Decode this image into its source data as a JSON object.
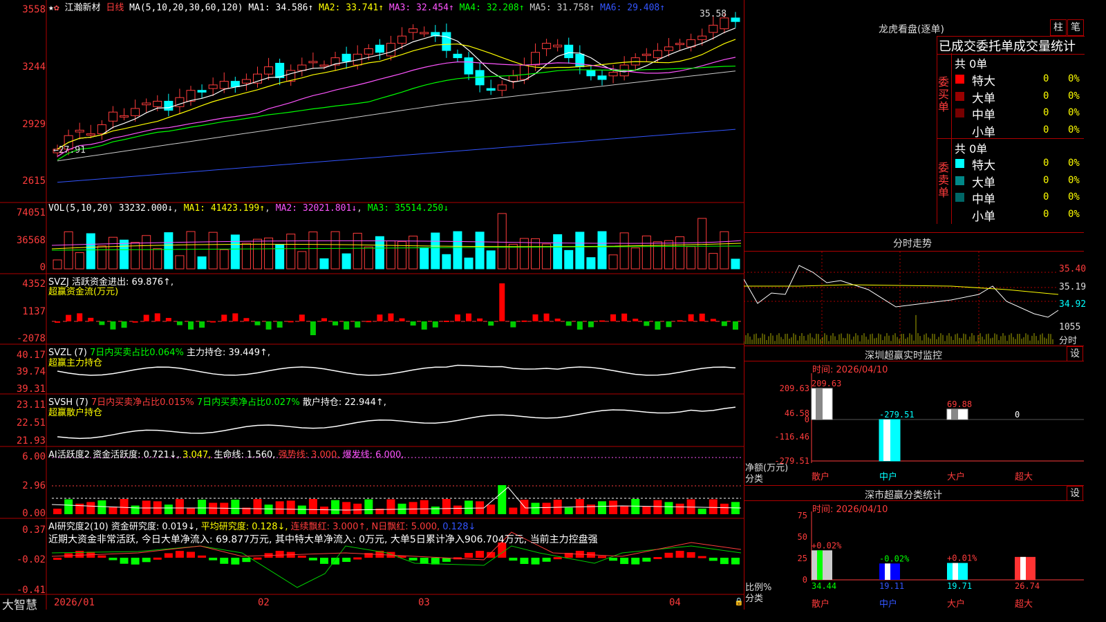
{
  "header": {
    "stock_name": "江瀚新材",
    "period": "日线",
    "ma_spec": "MA(5,10,20,30,60,120)",
    "ma": [
      {
        "label": "MA1: 34.586↑",
        "color": "#ffffff"
      },
      {
        "label": "MA2: 33.741↑",
        "color": "#ffff00"
      },
      {
        "label": "MA3: 32.454↑",
        "color": "#ff55ff"
      },
      {
        "label": "MA4: 32.208↑",
        "color": "#00ff00"
      },
      {
        "label": "MA5: 31.758↑",
        "color": "#cccccc"
      },
      {
        "label": "MA6: 29.408↑",
        "color": "#3355ff"
      }
    ],
    "high_mark": "35.58",
    "low_mark": "27.91"
  },
  "axes": {
    "price": [
      "3558",
      "3244",
      "2929",
      "2615"
    ],
    "vol": [
      "74051",
      "36568",
      "0"
    ],
    "svzj": [
      "4352",
      "1137",
      "-2078"
    ],
    "svzl": [
      "40.17",
      "39.74",
      "39.31"
    ],
    "svsh": [
      "23.11",
      "22.51",
      "21.93"
    ],
    "ai1": [
      "6.00",
      "2.96",
      "0.00"
    ],
    "ai2": [
      "0.37",
      "-0.02",
      "-0.41"
    ]
  },
  "panels": {
    "vol": {
      "spec": "VOL(5,10,20)",
      "v": "33232.000↓",
      "ma1": "MA1: 41423.199↑",
      "ma2": "MA2: 32021.801↓",
      "ma3": "MA3: 35514.250↓"
    },
    "svzj": {
      "spec": "SVZJ",
      "label": "活跃资金进出: 69.876↑,",
      "sub": "超赢资金流(万元)"
    },
    "svzl": {
      "spec": "SVZL (7)",
      "a": "7日内买卖占比0.064%",
      "b": "主力持仓: 39.449↑,",
      "sub": "超赢主力持仓"
    },
    "svsh": {
      "spec": "SVSH (7)",
      "a": "7日内买卖净占比0.015%",
      "b": "7日内买卖净占比0.027%",
      "c": "散户持仓: 22.944↑,",
      "sub": "超赢散户持仓"
    },
    "ai1": {
      "spec": "AI活跃度2",
      "a": "资金活跃度: 0.721↓,",
      "b": "3.047,",
      "c": "生命线: 1.560,",
      "d": "强势线: 3.000,",
      "e": "爆发线: 6.000,"
    },
    "ai2": {
      "spec": "AI研究度2(10)",
      "a": "资金研究度: 0.019↓,",
      "b": "平均研究度: 0.128↓,",
      "c": "连续飘红: 3.000↑,",
      "d": "N日飘红: 5.000,",
      "e": "0.128↓",
      "note": "近期大资金非常活跃, 今日大单净流入: 69.877万元, 其中特大单净流入: 0万元, 大单5日累计净入906.704万元, 当前主力控盘强"
    }
  },
  "x_axis": {
    "labels": [
      "2026/01",
      "02",
      "03",
      "04"
    ]
  },
  "footer": {
    "brand": "大智慧"
  },
  "lhb": {
    "title": "龙虎看盘(逐单)",
    "btn_col": "柱",
    "btn_pen": "笔",
    "tabs": "已成交委托单成交量统计",
    "buy_side": "委买单",
    "sell_side": "委卖单",
    "buy_total": "共 0单",
    "sell_total": "共 0单",
    "buy_rows": [
      {
        "name": "特大",
        "n": "0",
        "p": "0%",
        "c": "#ff0000"
      },
      {
        "name": "大单",
        "n": "0",
        "p": "0%",
        "c": "#990000"
      },
      {
        "name": "中单",
        "n": "0",
        "p": "0%",
        "c": "#770000"
      },
      {
        "name": "小单",
        "n": "0",
        "p": "0%",
        "c": ""
      }
    ],
    "sell_rows": [
      {
        "name": "特大",
        "n": "0",
        "p": "0%",
        "c": "#00ffff"
      },
      {
        "name": "大单",
        "n": "0",
        "p": "0%",
        "c": "#008888"
      },
      {
        "name": "中单",
        "n": "0",
        "p": "0%",
        "c": "#006666"
      },
      {
        "name": "小单",
        "n": "0",
        "p": "0%",
        "c": ""
      }
    ]
  },
  "intraday": {
    "title": "分时走势",
    "p1": "35.40",
    "p2": "35.19",
    "p3": "34.92",
    "vol": "1055",
    "unit": "分时"
  },
  "monitor": {
    "title": "深圳超赢实时监控",
    "btn": "设",
    "time": "时间: 2026/04/10",
    "axis": [
      "209.63",
      "46.58",
      "0",
      "-116.46",
      "-279.51"
    ],
    "bars": [
      {
        "name": "散户",
        "val": 209.63,
        "label": "209.63"
      },
      {
        "name": "中户",
        "val": -279.51,
        "label": "-279.51"
      },
      {
        "name": "大户",
        "val": 69.88,
        "label": "69.88"
      },
      {
        "name": "超大",
        "val": 0,
        "label": "0"
      }
    ],
    "ylabel": "净额(万元)",
    "xlabel": "分类"
  },
  "classify": {
    "title": "深市超赢分类统计",
    "btn": "设",
    "time": "时间: 2026/04/10",
    "axis": [
      "75",
      "50",
      "25",
      "0"
    ],
    "bars": [
      {
        "name": "散户",
        "val": 34.44,
        "chg": "+0.02%"
      },
      {
        "name": "中户",
        "val": 19.11,
        "chg": "-0.02%"
      },
      {
        "name": "大户",
        "val": 19.71,
        "chg": "+0.01%"
      },
      {
        "name": "超大",
        "val": 26.74,
        "chg": ""
      }
    ],
    "ylabel": "比例%",
    "xlabel": "分类"
  }
}
